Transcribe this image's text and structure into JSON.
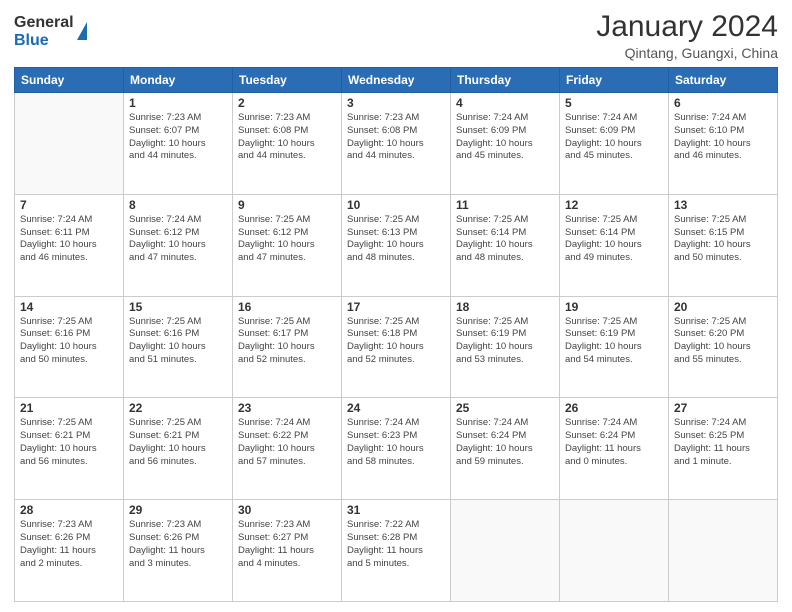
{
  "header": {
    "logo_general": "General",
    "logo_blue": "Blue",
    "month_year": "January 2024",
    "location": "Qintang, Guangxi, China"
  },
  "days_of_week": [
    "Sunday",
    "Monday",
    "Tuesday",
    "Wednesday",
    "Thursday",
    "Friday",
    "Saturday"
  ],
  "weeks": [
    [
      {
        "day": "",
        "info": ""
      },
      {
        "day": "1",
        "info": "Sunrise: 7:23 AM\nSunset: 6:07 PM\nDaylight: 10 hours\nand 44 minutes."
      },
      {
        "day": "2",
        "info": "Sunrise: 7:23 AM\nSunset: 6:08 PM\nDaylight: 10 hours\nand 44 minutes."
      },
      {
        "day": "3",
        "info": "Sunrise: 7:23 AM\nSunset: 6:08 PM\nDaylight: 10 hours\nand 44 minutes."
      },
      {
        "day": "4",
        "info": "Sunrise: 7:24 AM\nSunset: 6:09 PM\nDaylight: 10 hours\nand 45 minutes."
      },
      {
        "day": "5",
        "info": "Sunrise: 7:24 AM\nSunset: 6:09 PM\nDaylight: 10 hours\nand 45 minutes."
      },
      {
        "day": "6",
        "info": "Sunrise: 7:24 AM\nSunset: 6:10 PM\nDaylight: 10 hours\nand 46 minutes."
      }
    ],
    [
      {
        "day": "7",
        "info": "Sunrise: 7:24 AM\nSunset: 6:11 PM\nDaylight: 10 hours\nand 46 minutes."
      },
      {
        "day": "8",
        "info": "Sunrise: 7:24 AM\nSunset: 6:12 PM\nDaylight: 10 hours\nand 47 minutes."
      },
      {
        "day": "9",
        "info": "Sunrise: 7:25 AM\nSunset: 6:12 PM\nDaylight: 10 hours\nand 47 minutes."
      },
      {
        "day": "10",
        "info": "Sunrise: 7:25 AM\nSunset: 6:13 PM\nDaylight: 10 hours\nand 48 minutes."
      },
      {
        "day": "11",
        "info": "Sunrise: 7:25 AM\nSunset: 6:14 PM\nDaylight: 10 hours\nand 48 minutes."
      },
      {
        "day": "12",
        "info": "Sunrise: 7:25 AM\nSunset: 6:14 PM\nDaylight: 10 hours\nand 49 minutes."
      },
      {
        "day": "13",
        "info": "Sunrise: 7:25 AM\nSunset: 6:15 PM\nDaylight: 10 hours\nand 50 minutes."
      }
    ],
    [
      {
        "day": "14",
        "info": "Sunrise: 7:25 AM\nSunset: 6:16 PM\nDaylight: 10 hours\nand 50 minutes."
      },
      {
        "day": "15",
        "info": "Sunrise: 7:25 AM\nSunset: 6:16 PM\nDaylight: 10 hours\nand 51 minutes."
      },
      {
        "day": "16",
        "info": "Sunrise: 7:25 AM\nSunset: 6:17 PM\nDaylight: 10 hours\nand 52 minutes."
      },
      {
        "day": "17",
        "info": "Sunrise: 7:25 AM\nSunset: 6:18 PM\nDaylight: 10 hours\nand 52 minutes."
      },
      {
        "day": "18",
        "info": "Sunrise: 7:25 AM\nSunset: 6:19 PM\nDaylight: 10 hours\nand 53 minutes."
      },
      {
        "day": "19",
        "info": "Sunrise: 7:25 AM\nSunset: 6:19 PM\nDaylight: 10 hours\nand 54 minutes."
      },
      {
        "day": "20",
        "info": "Sunrise: 7:25 AM\nSunset: 6:20 PM\nDaylight: 10 hours\nand 55 minutes."
      }
    ],
    [
      {
        "day": "21",
        "info": "Sunrise: 7:25 AM\nSunset: 6:21 PM\nDaylight: 10 hours\nand 56 minutes."
      },
      {
        "day": "22",
        "info": "Sunrise: 7:25 AM\nSunset: 6:21 PM\nDaylight: 10 hours\nand 56 minutes."
      },
      {
        "day": "23",
        "info": "Sunrise: 7:24 AM\nSunset: 6:22 PM\nDaylight: 10 hours\nand 57 minutes."
      },
      {
        "day": "24",
        "info": "Sunrise: 7:24 AM\nSunset: 6:23 PM\nDaylight: 10 hours\nand 58 minutes."
      },
      {
        "day": "25",
        "info": "Sunrise: 7:24 AM\nSunset: 6:24 PM\nDaylight: 10 hours\nand 59 minutes."
      },
      {
        "day": "26",
        "info": "Sunrise: 7:24 AM\nSunset: 6:24 PM\nDaylight: 11 hours\nand 0 minutes."
      },
      {
        "day": "27",
        "info": "Sunrise: 7:24 AM\nSunset: 6:25 PM\nDaylight: 11 hours\nand 1 minute."
      }
    ],
    [
      {
        "day": "28",
        "info": "Sunrise: 7:23 AM\nSunset: 6:26 PM\nDaylight: 11 hours\nand 2 minutes."
      },
      {
        "day": "29",
        "info": "Sunrise: 7:23 AM\nSunset: 6:26 PM\nDaylight: 11 hours\nand 3 minutes."
      },
      {
        "day": "30",
        "info": "Sunrise: 7:23 AM\nSunset: 6:27 PM\nDaylight: 11 hours\nand 4 minutes."
      },
      {
        "day": "31",
        "info": "Sunrise: 7:22 AM\nSunset: 6:28 PM\nDaylight: 11 hours\nand 5 minutes."
      },
      {
        "day": "",
        "info": ""
      },
      {
        "day": "",
        "info": ""
      },
      {
        "day": "",
        "info": ""
      }
    ]
  ]
}
